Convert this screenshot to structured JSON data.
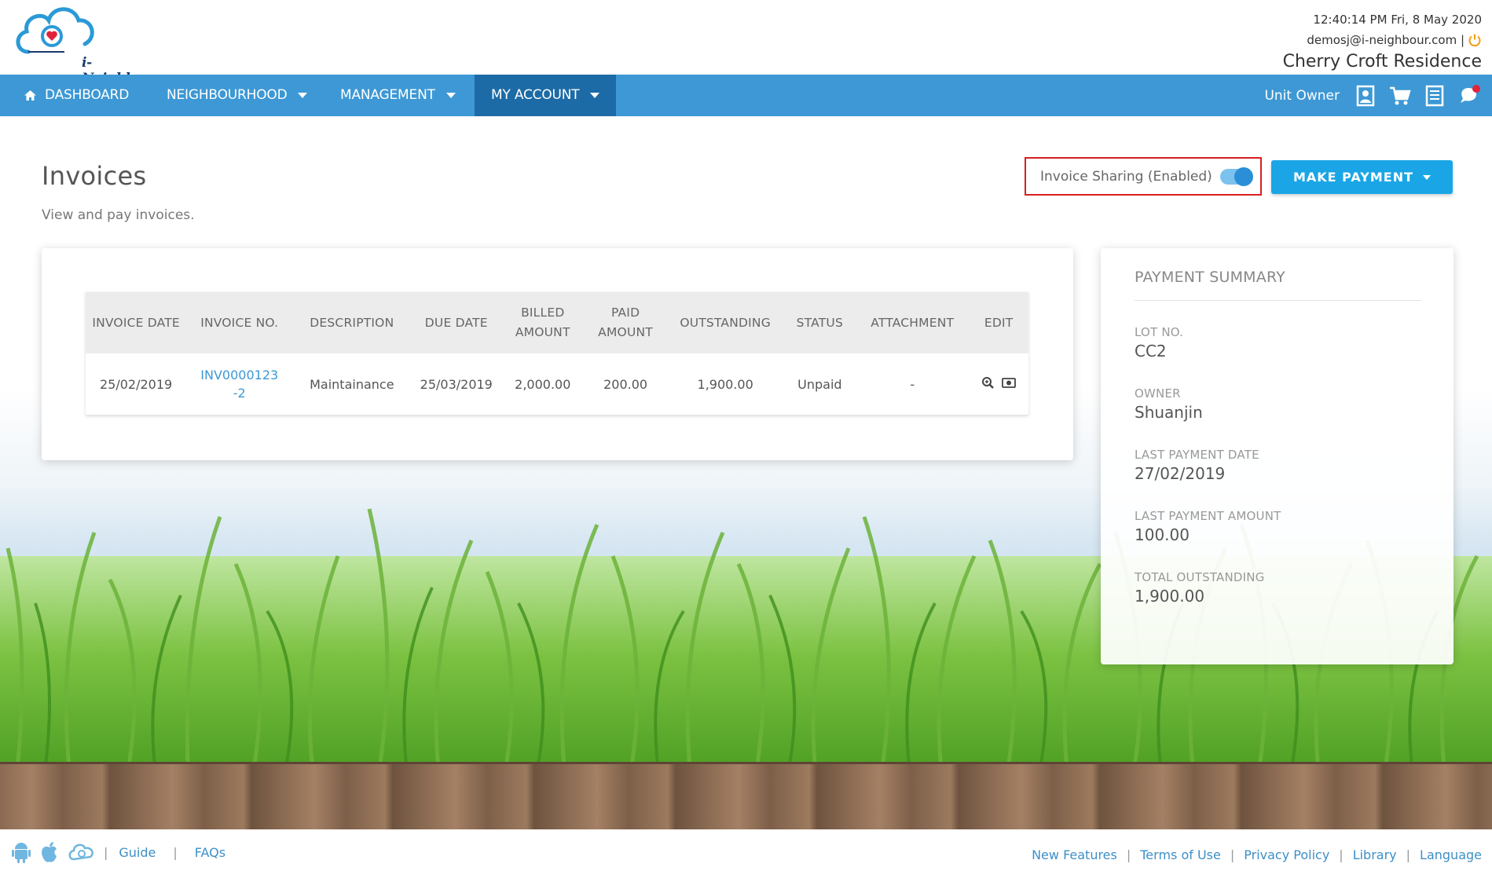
{
  "header": {
    "brand": "i-Neighbour",
    "datetime": "12:40:14 PM  Fri, 8 May 2020",
    "email": "demosj@i-neighbour.com |",
    "site": "Cherry Croft Residence"
  },
  "nav": {
    "items": [
      {
        "label": "DASHBOARD"
      },
      {
        "label": "NEIGHBOURHOOD"
      },
      {
        "label": "MANAGEMENT"
      },
      {
        "label": "MY ACCOUNT"
      }
    ],
    "role": "Unit Owner"
  },
  "page": {
    "title": "Invoices",
    "subtitle": "View and pay invoices.",
    "sharing_label": "Invoice Sharing (Enabled)",
    "sharing_enabled": true,
    "pay_button": "MAKE PAYMENT"
  },
  "table": {
    "headers": [
      "INVOICE DATE",
      "INVOICE NO.",
      "DESCRIPTION",
      "DUE DATE",
      "BILLED AMOUNT",
      "PAID AMOUNT",
      "OUTSTANDING",
      "STATUS",
      "ATTACHMENT",
      "EDIT"
    ],
    "rows": [
      {
        "invoice_date": "25/02/2019",
        "invoice_no": "INV0000123-2",
        "description": "Maintainance",
        "due_date": "25/03/2019",
        "billed": "2,000.00",
        "paid": "200.00",
        "outstanding": "1,900.00",
        "status": "Unpaid",
        "attachment": "-"
      }
    ]
  },
  "summary": {
    "title": "PAYMENT SUMMARY",
    "fields": [
      {
        "label": "LOT NO.",
        "value": "CC2"
      },
      {
        "label": "OWNER",
        "value": "Shuanjin"
      },
      {
        "label": "LAST PAYMENT DATE",
        "value": "27/02/2019"
      },
      {
        "label": "LAST PAYMENT AMOUNT",
        "value": "100.00"
      },
      {
        "label": "TOTAL OUTSTANDING",
        "value": "1,900.00"
      }
    ]
  },
  "footer": {
    "left_links": [
      "Guide",
      "FAQs"
    ],
    "right_links": [
      "New Features",
      "Terms of Use",
      "Privacy Policy",
      "Library",
      "Language"
    ]
  },
  "colors": {
    "nav_bg": "#3d98d5",
    "nav_active": "#1d6ba6",
    "accent_button": "#1aa6e6",
    "link": "#3d98d5",
    "highlight_border": "#d81f1f"
  },
  "icons": [
    "logo-cloud-icon",
    "power-icon",
    "home-icon",
    "contact-card-icon",
    "cart-icon",
    "document-icon",
    "chat-notification-icon",
    "zoom-icon",
    "view-icon",
    "android-icon",
    "apple-icon",
    "cloud-app-icon"
  ]
}
